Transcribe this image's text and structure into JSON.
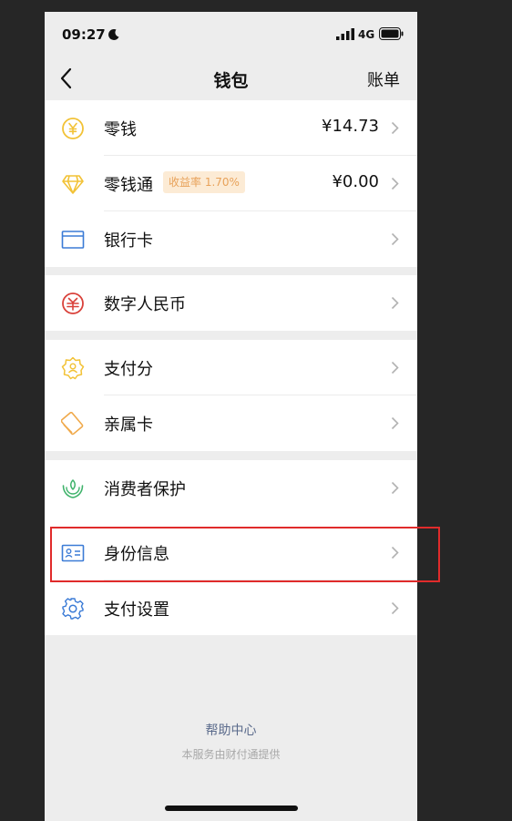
{
  "status_bar": {
    "time": "09:27",
    "network": "4G"
  },
  "nav": {
    "title": "钱包",
    "right_action": "账单"
  },
  "groups": [
    {
      "items": [
        {
          "label": "零钱",
          "value": "¥14.73",
          "icon": "yuan-coin-icon",
          "color": "#f2c236"
        },
        {
          "label": "零钱通",
          "badge": "收益率 1.70%",
          "value": "¥0.00",
          "icon": "diamond-icon",
          "color": "#f2c236"
        },
        {
          "label": "银行卡",
          "icon": "bank-card-icon",
          "color": "#3b7bd6"
        }
      ]
    },
    {
      "items": [
        {
          "label": "数字人民币",
          "icon": "digital-rmb-icon",
          "color": "#d9413a"
        }
      ]
    },
    {
      "items": [
        {
          "label": "支付分",
          "icon": "pay-score-icon",
          "color": "#f2c236"
        },
        {
          "label": "亲属卡",
          "icon": "family-card-icon",
          "color": "#f0a94a"
        }
      ]
    },
    {
      "items": [
        {
          "label": "消费者保护",
          "icon": "consumer-protection-icon",
          "color": "#3fb36b"
        },
        {
          "label": "身份信息",
          "icon": "id-card-icon",
          "color": "#3b7bd6"
        },
        {
          "label": "支付设置",
          "icon": "settings-gear-icon",
          "color": "#3b7bd6"
        }
      ]
    }
  ],
  "footer": {
    "help": "帮助中心",
    "note": "本服务由财付通提供"
  },
  "highlight_color": "#e02b2b"
}
